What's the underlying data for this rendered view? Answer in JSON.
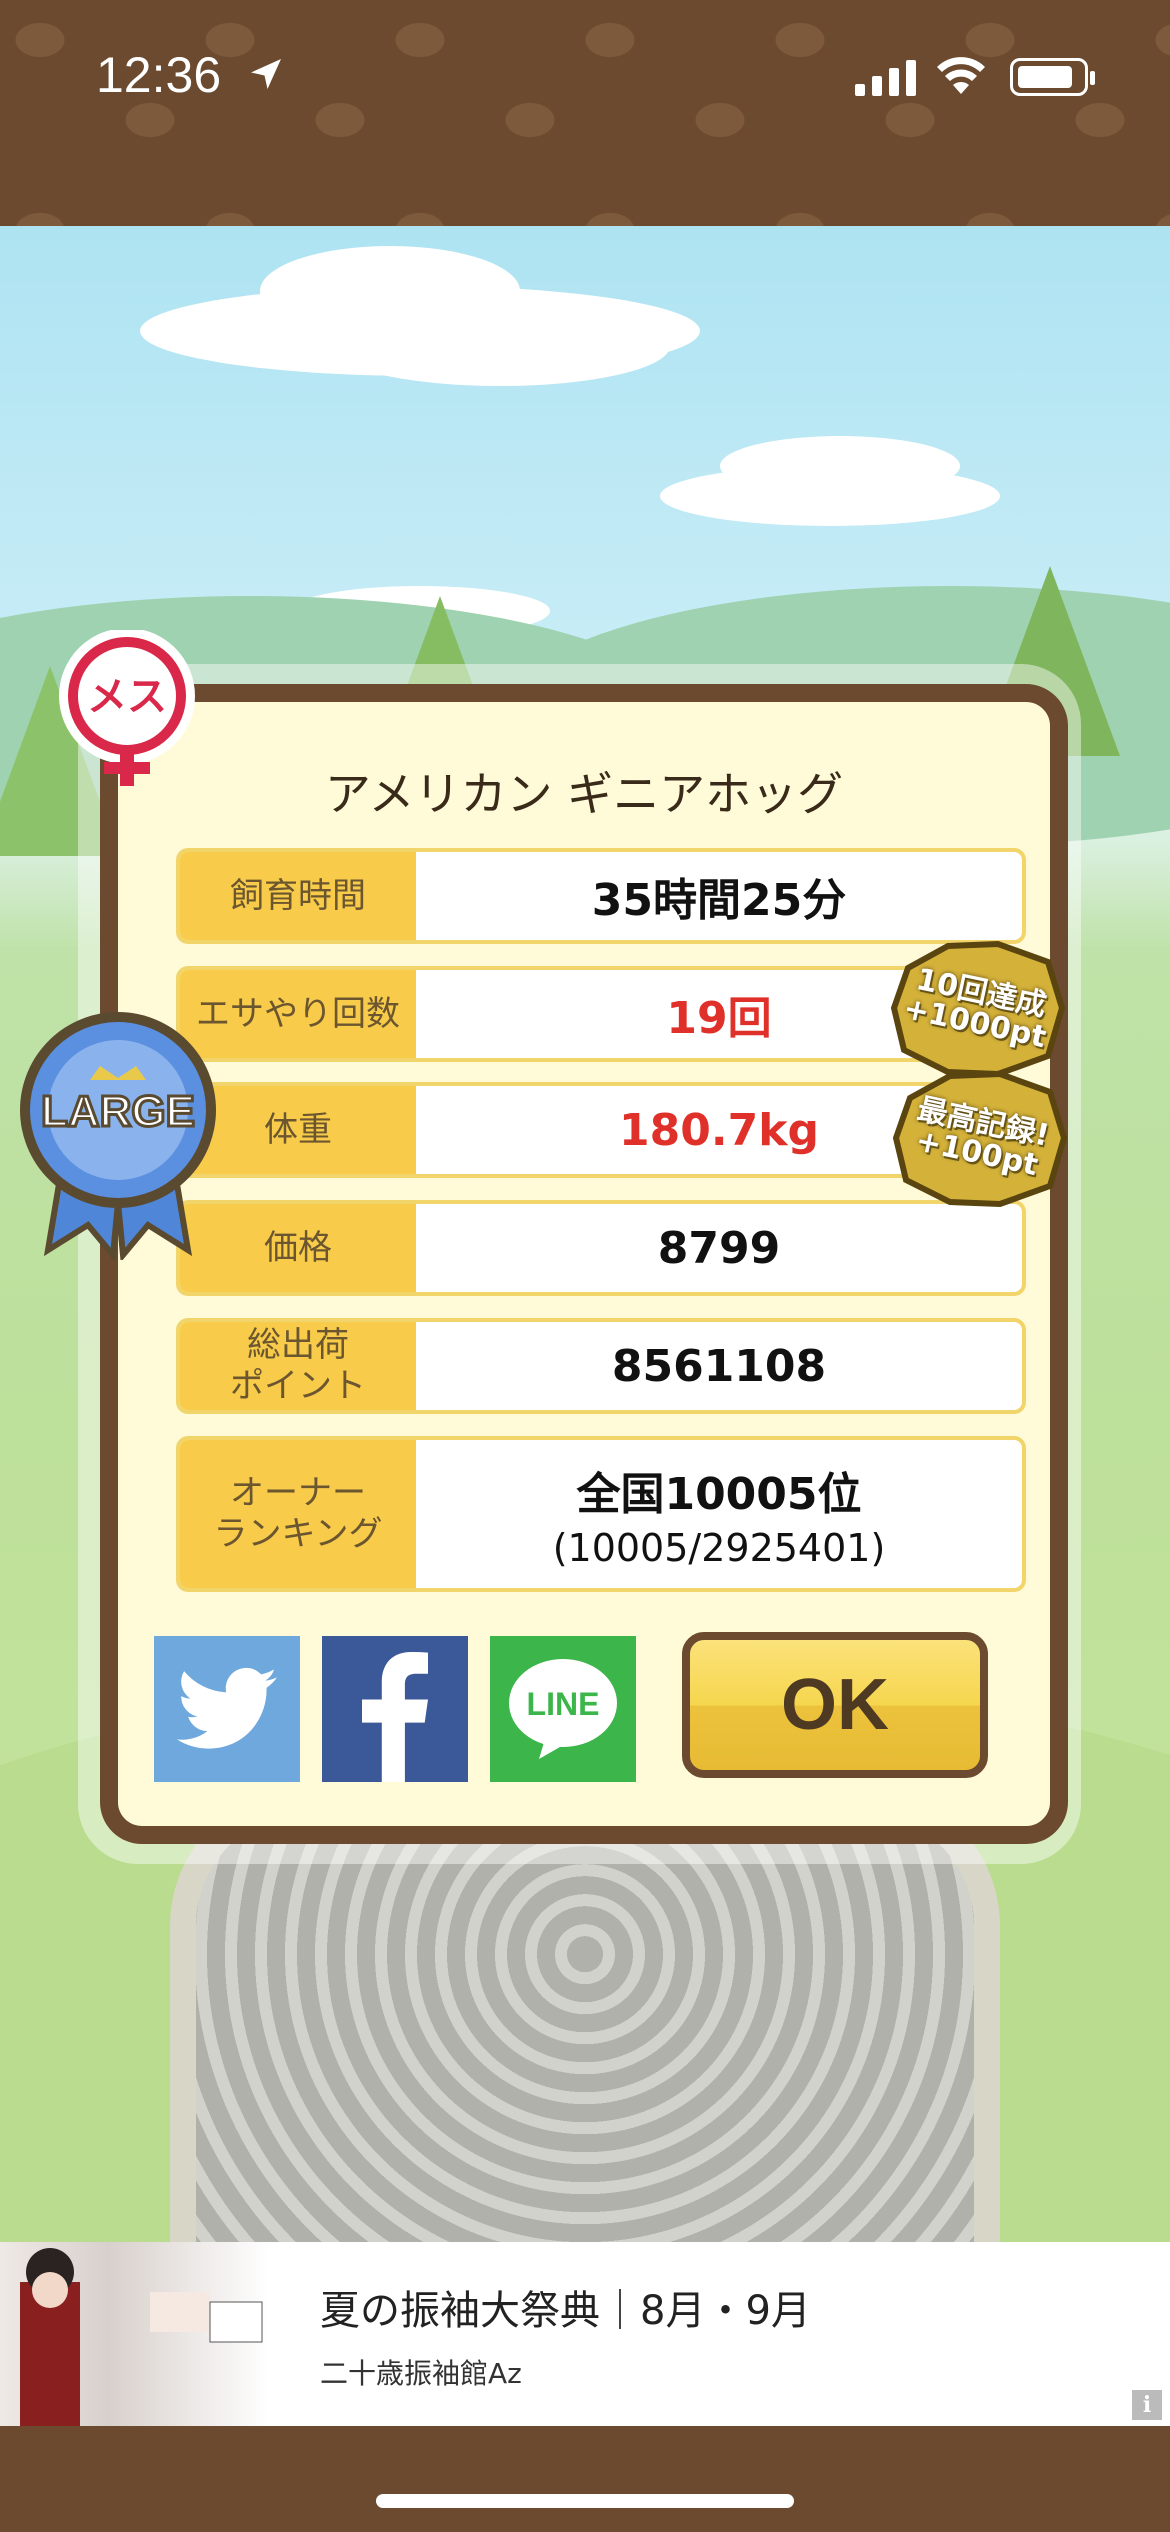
{
  "status_bar": {
    "time": "12:36",
    "battery_level": 0.78
  },
  "dialog": {
    "title": "アメリカン ギニアホッグ",
    "rows": [
      {
        "label": "飼育時間",
        "value": "35時間25分",
        "highlight": false
      },
      {
        "label": "エサやり回数",
        "value": "19回",
        "highlight": true
      },
      {
        "label": "体重",
        "value": "180.7kg",
        "highlight": true
      },
      {
        "label": "価格",
        "value": "8799",
        "highlight": false
      },
      {
        "label": "総出荷\nポイント",
        "value": "8561108",
        "highlight": false
      },
      {
        "label": "オーナー\nランキング",
        "value": "全国10005位",
        "sub": "(10005/2925401)",
        "highlight": false
      }
    ],
    "ok_label": "OK",
    "line_label": "LINE"
  },
  "badges": {
    "gender": "メス",
    "size": "LARGE",
    "bonus1_line1": "10回達成",
    "bonus1_line2": "+1000pt",
    "bonus2_line1": "最高記録!",
    "bonus2_line2": "+100pt"
  },
  "ad": {
    "title": "夏の振袖大祭典｜8月・9月",
    "advertiser": "二十歳振袖館Az",
    "info": "i"
  },
  "colors": {
    "frame_brown": "#6b4a2f",
    "label_yellow": "#f8cc4a",
    "highlight_red": "#e0302a",
    "twitter": "#6fa8dc",
    "facebook": "#3b5998",
    "line": "#3cb64a"
  }
}
